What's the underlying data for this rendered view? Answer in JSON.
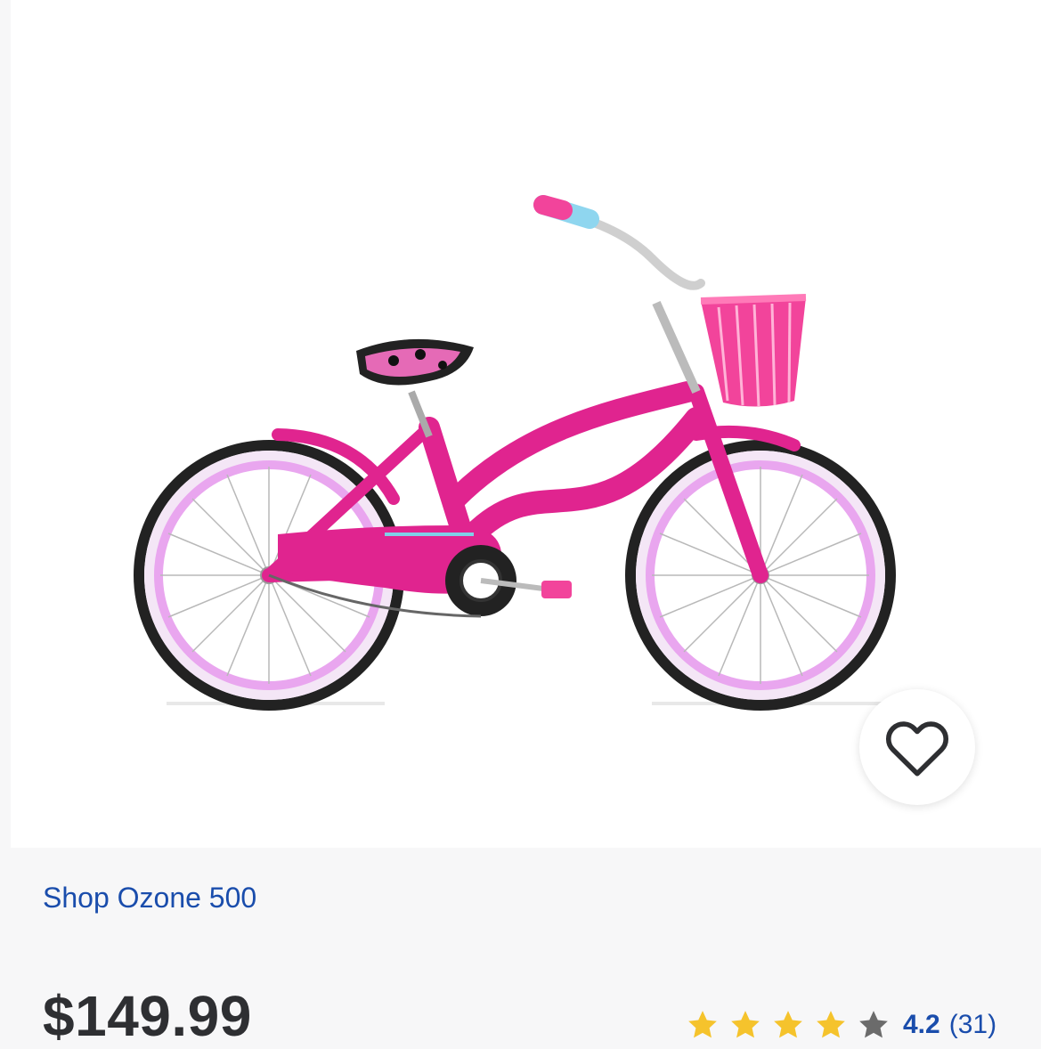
{
  "product": {
    "image_alt": "Ozone 500 Island Girl pink kids bicycle with basket",
    "frame_color": "#e0248f",
    "rim_color": "#e9a6ef",
    "basket_color": "#f2449b"
  },
  "favorite": {
    "icon": "heart-outline-icon"
  },
  "shop_link": {
    "label": "Shop Ozone 500",
    "color": "#1a4dac"
  },
  "price": {
    "label": "$149.99"
  },
  "rating": {
    "stars_filled": 4,
    "stars_total": 5,
    "value": "4.2",
    "count": "(31)",
    "star_color": "#f5c32c",
    "empty_star_color": "#6b6b6b"
  }
}
